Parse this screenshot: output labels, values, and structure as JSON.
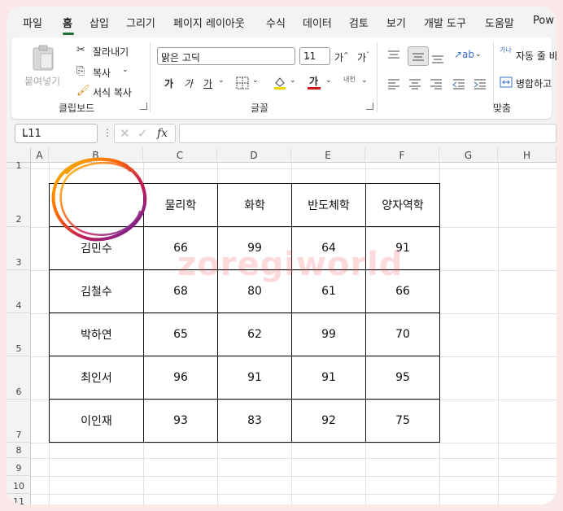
{
  "menu": {
    "items": [
      "파일",
      "홈",
      "삽입",
      "그리기",
      "페이지 레이아웃",
      "수식",
      "데이터",
      "검토",
      "보기",
      "개발 도구",
      "도움말",
      "Pow"
    ],
    "active_index": 1
  },
  "ribbon": {
    "clipboard": {
      "paste_label": "붙여넣기",
      "cut_label": "잘라내기",
      "copy_label": "복사",
      "format_painter_label": "서식 복사",
      "group_label": "클립보드"
    },
    "font": {
      "font_name": "맑은 고딕",
      "font_size": "11",
      "bold": "가",
      "italic": "가",
      "underline": "가",
      "font_color_label": "가",
      "phonetic_label": "내천",
      "grow_label": "가",
      "shrink_label": "가",
      "group_label": "글꼴",
      "fill_color": "#f2d600",
      "font_color": "#d11818"
    },
    "alignment": {
      "wrap_text_label": "자동 줄 바",
      "wrap_icon_label": "가나",
      "merge_label": "병합하고",
      "group_label": "맞춤"
    }
  },
  "formula_bar": {
    "name_box": "L11",
    "fx_label": "fx",
    "formula": ""
  },
  "sheet": {
    "columns": [
      "A",
      "B",
      "C",
      "D",
      "E",
      "F",
      "G",
      "H"
    ],
    "rows": [
      "1",
      "2",
      "3",
      "4",
      "5",
      "6",
      "7",
      "8",
      "9",
      "10",
      "11"
    ],
    "table": {
      "header": [
        "",
        "물리학",
        "화학",
        "반도체학",
        "양자역학"
      ],
      "rows": [
        [
          "김민수",
          "66",
          "99",
          "64",
          "91"
        ],
        [
          "김철수",
          "68",
          "80",
          "61",
          "66"
        ],
        [
          "박하연",
          "65",
          "62",
          "99",
          "70"
        ],
        [
          "최인서",
          "96",
          "91",
          "91",
          "95"
        ],
        [
          "이인재",
          "93",
          "83",
          "92",
          "75"
        ]
      ]
    },
    "watermark": "zoregiworld"
  },
  "colors": {
    "accent": "#1e6e3a",
    "page_border": "#fbe9ea"
  }
}
